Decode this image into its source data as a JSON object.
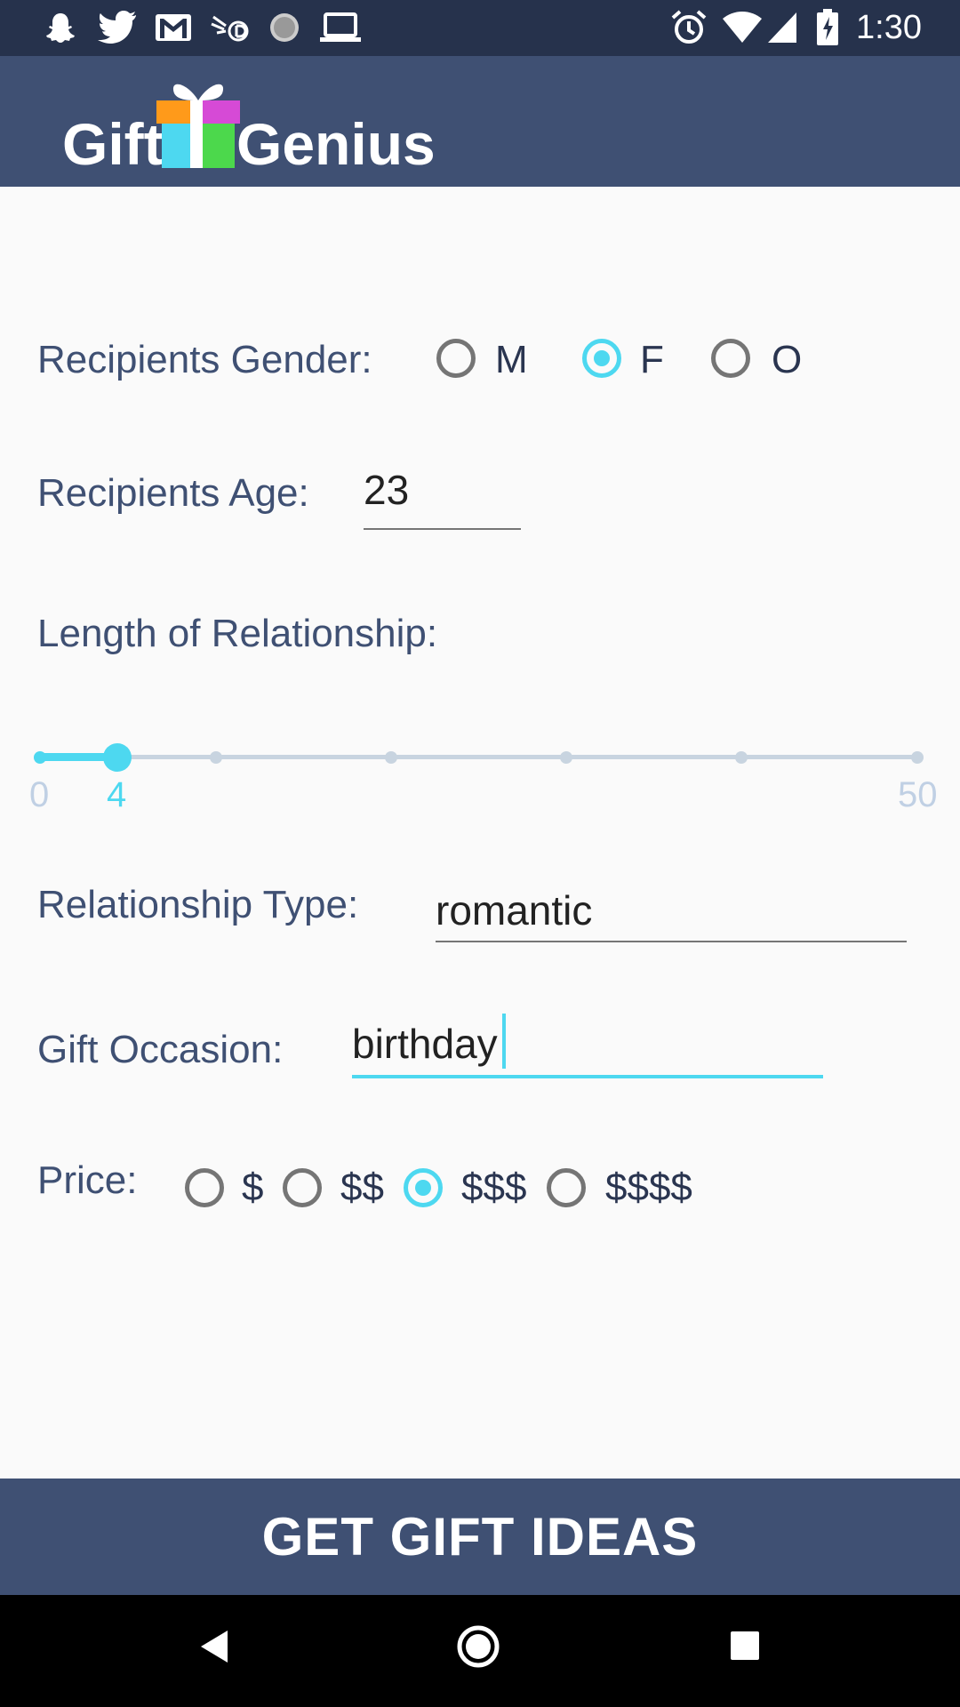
{
  "status_bar": {
    "time": "1:30",
    "left_icons": [
      "snapchat-icon",
      "twitter-icon",
      "gmail-icon",
      "speed-icon",
      "sync-icon",
      "laptop-icon"
    ],
    "right_icons": [
      "alarm-icon",
      "wifi-icon",
      "signal-icon",
      "battery-charging-icon"
    ]
  },
  "app_bar": {
    "logo_left": "Gift",
    "logo_right": "Genius",
    "logo_colors": [
      "#ff9a1a",
      "#4dd8f0",
      "#d64ad6",
      "#4cd84c"
    ]
  },
  "form": {
    "gender": {
      "label": "Recipients Gender:",
      "options": [
        "M",
        "F",
        "O"
      ],
      "selected": "F"
    },
    "age": {
      "label": "Recipients Age:",
      "value": "23"
    },
    "relationship_length": {
      "label": "Length of Relationship:",
      "min": "0",
      "max": "50",
      "value": "4"
    },
    "relationship_type": {
      "label": "Relationship Type:",
      "value": "romantic"
    },
    "occasion": {
      "label": "Gift Occasion:",
      "value": "birthday"
    },
    "price": {
      "label": "Price:",
      "options": [
        "$",
        "$$",
        "$$$",
        "$$$$"
      ],
      "selected": "$$$"
    }
  },
  "cta": {
    "label": "GET GIFT IDEAS"
  },
  "colors": {
    "primary": "#3f5073",
    "accent": "#4dd8f0",
    "status_bar": "#26324c"
  }
}
